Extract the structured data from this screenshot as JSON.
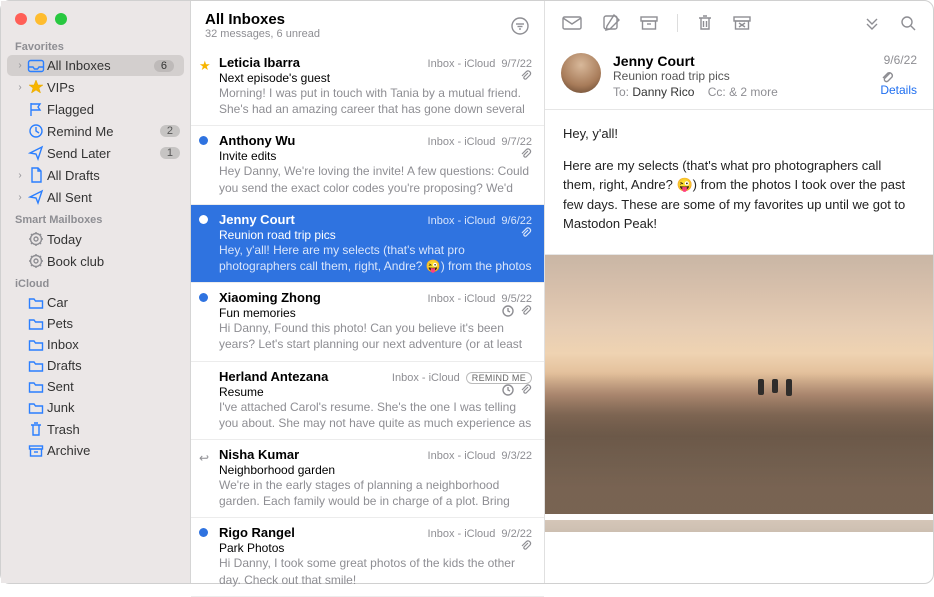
{
  "sidebar": {
    "sections": [
      {
        "label": "Favorites",
        "items": [
          {
            "name": "all-inboxes",
            "label": "All Inboxes",
            "icon": "tray",
            "chev": true,
            "badge": "6",
            "selected": true
          },
          {
            "name": "vips",
            "label": "VIPs",
            "icon": "star",
            "chev": true
          },
          {
            "name": "flagged",
            "label": "Flagged",
            "icon": "flag"
          },
          {
            "name": "remind-me",
            "label": "Remind Me",
            "icon": "clock",
            "badge": "2"
          },
          {
            "name": "send-later",
            "label": "Send Later",
            "icon": "paperplane",
            "badge": "1"
          },
          {
            "name": "all-drafts",
            "label": "All Drafts",
            "icon": "doc",
            "chev": true
          },
          {
            "name": "all-sent",
            "label": "All Sent",
            "icon": "sent",
            "chev": true
          }
        ]
      },
      {
        "label": "Smart Mailboxes",
        "items": [
          {
            "name": "today",
            "label": "Today",
            "icon": "gear"
          },
          {
            "name": "book-club",
            "label": "Book club",
            "icon": "gear"
          }
        ]
      },
      {
        "label": "iCloud",
        "items": [
          {
            "name": "car",
            "label": "Car",
            "icon": "folder"
          },
          {
            "name": "pets",
            "label": "Pets",
            "icon": "folder"
          },
          {
            "name": "inbox",
            "label": "Inbox",
            "icon": "folder"
          },
          {
            "name": "drafts",
            "label": "Drafts",
            "icon": "folder"
          },
          {
            "name": "sent",
            "label": "Sent",
            "icon": "folder"
          },
          {
            "name": "junk",
            "label": "Junk",
            "icon": "folder"
          },
          {
            "name": "trash",
            "label": "Trash",
            "icon": "trash-folder"
          },
          {
            "name": "archive",
            "label": "Archive",
            "icon": "archive-folder"
          }
        ]
      }
    ]
  },
  "list": {
    "title": "All Inboxes",
    "subtitle": "32 messages, 6 unread",
    "messages": [
      {
        "sender": "Leticia Ibarra",
        "mailbox": "Inbox - iCloud",
        "date": "9/7/22",
        "subject": "Next episode's guest",
        "preview": "Morning! I was put in touch with Tania by a mutual friend. She's had an amazing career that has gone down several paths.",
        "star": true,
        "attach": true
      },
      {
        "sender": "Anthony Wu",
        "mailbox": "Inbox - iCloud",
        "date": "9/7/22",
        "subject": "Invite edits",
        "preview": "Hey Danny, We're loving the invite! A few questions: Could you send the exact color codes you're proposing? We'd like to see…",
        "unread": true,
        "attach": true
      },
      {
        "sender": "Jenny Court",
        "mailbox": "Inbox - iCloud",
        "date": "9/6/22",
        "subject": "Reunion road trip pics",
        "preview": "Hey, y'all! Here are my selects (that's what pro photographers call them, right, Andre? 😜) from the photos I took over the pa…",
        "unread": true,
        "attach": true,
        "selected": true
      },
      {
        "sender": "Xiaoming Zhong",
        "mailbox": "Inbox - iCloud",
        "date": "9/5/22",
        "subject": "Fun memories",
        "preview": "Hi Danny, Found this photo! Can you believe it's been years? Let's start planning our next adventure (or at least plan…",
        "unread": true,
        "attach": true,
        "clock": true
      },
      {
        "sender": "Herland Antezana",
        "mailbox": "Inbox - iCloud",
        "date": "",
        "subject": "Resume",
        "preview": "I've attached Carol's resume. She's the one I was telling you about. She may not have quite as much experience as you're lo…",
        "attach": true,
        "clock": true,
        "remind": "REMIND ME"
      },
      {
        "sender": "Nisha Kumar",
        "mailbox": "Inbox - iCloud",
        "date": "9/3/22",
        "subject": "Neighborhood garden",
        "preview": "We're in the early stages of planning a neighborhood garden. Each family would be in charge of a plot. Bring your own wateri…",
        "unread": true,
        "replied": true
      },
      {
        "sender": "Rigo Rangel",
        "mailbox": "Inbox - iCloud",
        "date": "9/2/22",
        "subject": "Park Photos",
        "preview": "Hi Danny, I took some great photos of the kids the other day. Check out that smile!",
        "unread": true,
        "attach": true
      }
    ]
  },
  "viewer": {
    "from": "Jenny Court",
    "subject": "Reunion road trip pics",
    "date": "9/6/22",
    "to_label": "To:",
    "to": "Danny Rico",
    "cc_label": "Cc:",
    "cc": "& 2 more",
    "details": "Details",
    "body_line1": "Hey, y'all!",
    "body_line2_a": "Here are my selects (that's what pro photographers call them, right, Andre? ",
    "body_line2_b": ") from the photos I took over the past few days. These are some of my favorites up until we got to Mastodon Peak!"
  }
}
